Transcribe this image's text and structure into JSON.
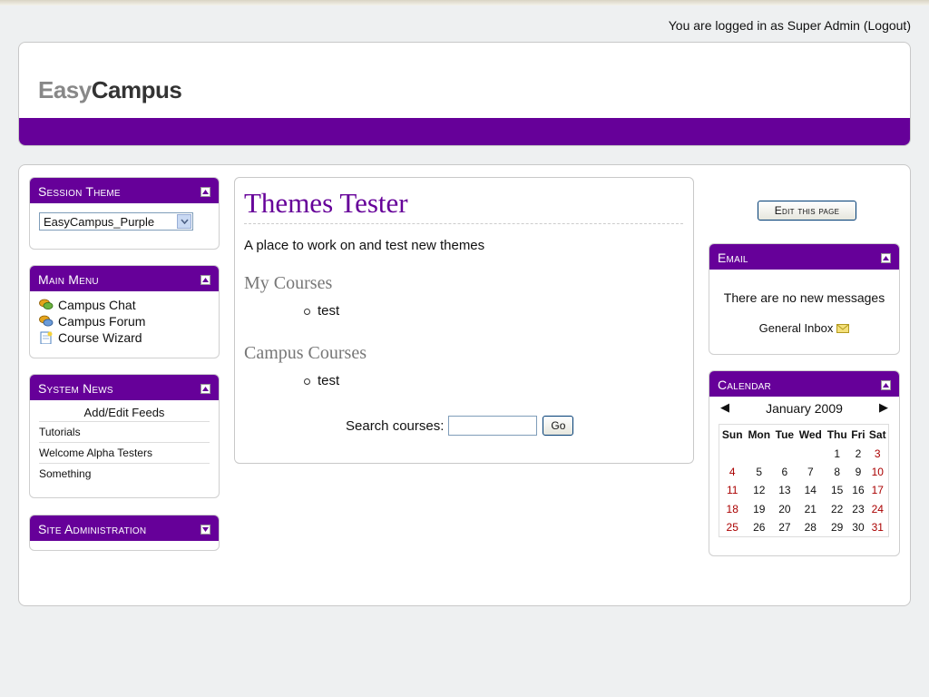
{
  "header": {
    "login_text": "You are logged in as Super Admin",
    "logout_label": "(Logout)",
    "logo_easy": "Easy",
    "logo_campus": "Campus"
  },
  "colors": {
    "accent": "#660099",
    "weekend": "#aa0000",
    "heading_grey": "#777777"
  },
  "left": {
    "session_theme": {
      "title": "Session Theme",
      "selected": "EasyCampus_Purple"
    },
    "main_menu": {
      "title": "Main Menu",
      "items": [
        {
          "label": "Campus Chat",
          "icon": "chat-icon"
        },
        {
          "label": "Campus Forum",
          "icon": "forum-icon"
        },
        {
          "label": "Course Wizard",
          "icon": "wizard-icon"
        }
      ]
    },
    "system_news": {
      "title": "System News",
      "feeds_link": "Add/Edit Feeds",
      "items": [
        "Tutorials",
        "Welcome Alpha Testers",
        "Something"
      ]
    },
    "site_admin": {
      "title": "Site Administration"
    }
  },
  "main": {
    "title": "Themes Tester",
    "summary": "A place to work on and test new themes",
    "my_courses": {
      "heading": "My Courses",
      "items": [
        "test"
      ]
    },
    "campus_courses": {
      "heading": "Campus Courses",
      "items": [
        "test"
      ]
    },
    "search_label": "Search courses:",
    "search_value": "",
    "go_label": "Go"
  },
  "right": {
    "edit_button": "Edit this page",
    "email": {
      "title": "Email",
      "message": "There are no new messages",
      "inbox_link": "General Inbox"
    },
    "calendar": {
      "title": "Calendar",
      "month": "January 2009",
      "prev": "◀",
      "next": "▶",
      "weekdays": [
        "Sun",
        "Mon",
        "Tue",
        "Wed",
        "Thu",
        "Fri",
        "Sat"
      ],
      "weeks": [
        [
          "",
          "",
          "",
          "",
          "1",
          "2",
          "3"
        ],
        [
          "4",
          "5",
          "6",
          "7",
          "8",
          "9",
          "10"
        ],
        [
          "11",
          "12",
          "13",
          "14",
          "15",
          "16",
          "17"
        ],
        [
          "18",
          "19",
          "20",
          "21",
          "22",
          "23",
          "24"
        ],
        [
          "25",
          "26",
          "27",
          "28",
          "29",
          "30",
          "31"
        ]
      ]
    }
  }
}
